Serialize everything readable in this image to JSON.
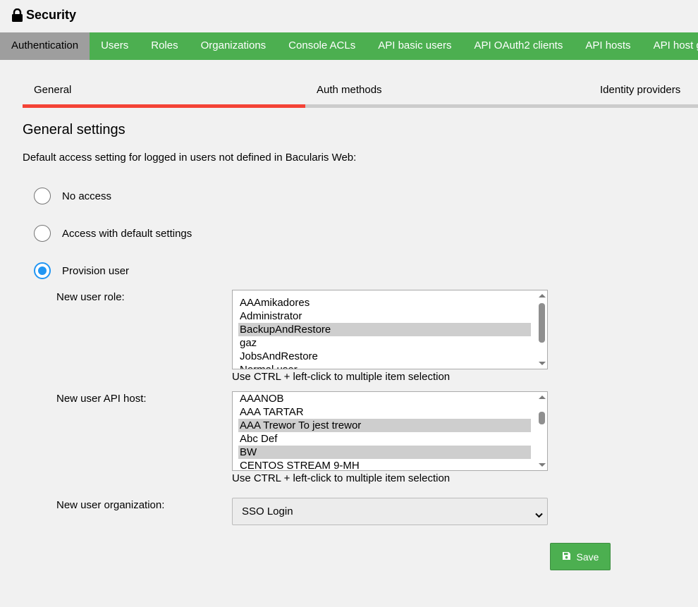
{
  "header": {
    "title": "Security",
    "icon": "lock-icon"
  },
  "top_tabs": [
    {
      "label": "Authentication",
      "active": true
    },
    {
      "label": "Users"
    },
    {
      "label": "Roles"
    },
    {
      "label": "Organizations"
    },
    {
      "label": "Console ACLs"
    },
    {
      "label": "API basic users"
    },
    {
      "label": "API OAuth2 clients"
    },
    {
      "label": "API hosts"
    },
    {
      "label": "API host groups"
    }
  ],
  "sub_tabs": [
    {
      "label": "General",
      "active": true
    },
    {
      "label": "Auth methods"
    },
    {
      "label": "Identity providers"
    }
  ],
  "section": {
    "title": "General settings",
    "description": "Default access setting for logged in users not defined in Bacularis Web:"
  },
  "access_options": [
    {
      "label": "No access",
      "checked": false
    },
    {
      "label": "Access with default settings",
      "checked": false
    },
    {
      "label": "Provision user",
      "checked": true
    }
  ],
  "role_field": {
    "label": "New user role:",
    "options": [
      "AAAmikadores",
      "Administrator",
      "BackupAndRestore",
      "gaz",
      "JobsAndRestore",
      "Normal user"
    ],
    "selected": [
      "BackupAndRestore"
    ],
    "hint": "Use CTRL + left-click to multiple item selection"
  },
  "api_host_field": {
    "label": "New user API host:",
    "options": [
      "AAANOB",
      "AAA TARTAR",
      "AAA Trewor To jest trewor",
      "Abc Def",
      "BW",
      "CENTOS STREAM 9-MH"
    ],
    "selected": [
      "AAA Trewor To jest trewor",
      "BW"
    ],
    "hint": "Use CTRL + left-click to multiple item selection"
  },
  "organization_field": {
    "label": "New user organization:",
    "value": "SSO Login"
  },
  "save_button": {
    "label": "Save",
    "icon": "save-icon"
  },
  "colors": {
    "tab_bar": "#4caf50",
    "active_tab": "#9e9e9e",
    "sub_tab_indicator": "#f44336",
    "radio_checked": "#2196f3",
    "selected_item": "#cecece",
    "save_button": "#4caf50"
  }
}
